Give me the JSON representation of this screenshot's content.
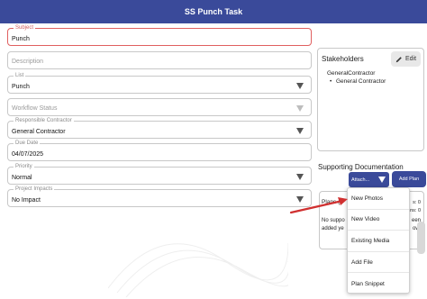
{
  "header": {
    "title": "SS Punch Task"
  },
  "form": {
    "subject": {
      "label": "Subject",
      "value": "Punch"
    },
    "description": {
      "placeholder": "Description"
    },
    "list": {
      "label": "List",
      "value": "Punch"
    },
    "workflow_status": {
      "placeholder": "Workflow Status"
    },
    "responsible_contractor": {
      "label": "Responsible Contractor",
      "value": "General Contractor"
    },
    "due_date": {
      "label": "Due Date",
      "value": "04/07/2025"
    },
    "priority": {
      "label": "Priority",
      "value": "Normal"
    },
    "project_impacts": {
      "label": "Project Impacts",
      "value": "No Impact"
    }
  },
  "stakeholders": {
    "title": "Stakeholders",
    "edit_label": "Edit",
    "group": "GeneralContractor",
    "member": "General Contractor"
  },
  "supporting": {
    "title": "Supporting Documentation",
    "attach_label": "Attach...",
    "add_plan_label": "Add Plan",
    "plans_text": "Plans (",
    "counts_line1": "s: 0",
    "counts_line2": "ans: 0",
    "no_supp_line1": "No suppo",
    "no_supp_line2": "added ye",
    "right_line1": "een",
    "right_line2": "ow."
  },
  "attach_menu": {
    "items": [
      "New Photos",
      "New Video",
      "Existing Media",
      "Add File",
      "Plan Snippet"
    ]
  },
  "colors": {
    "header": "#3a4a9a",
    "accent": "#3a4a9a",
    "active_border": "#e06060",
    "arrow": "#d03030"
  }
}
